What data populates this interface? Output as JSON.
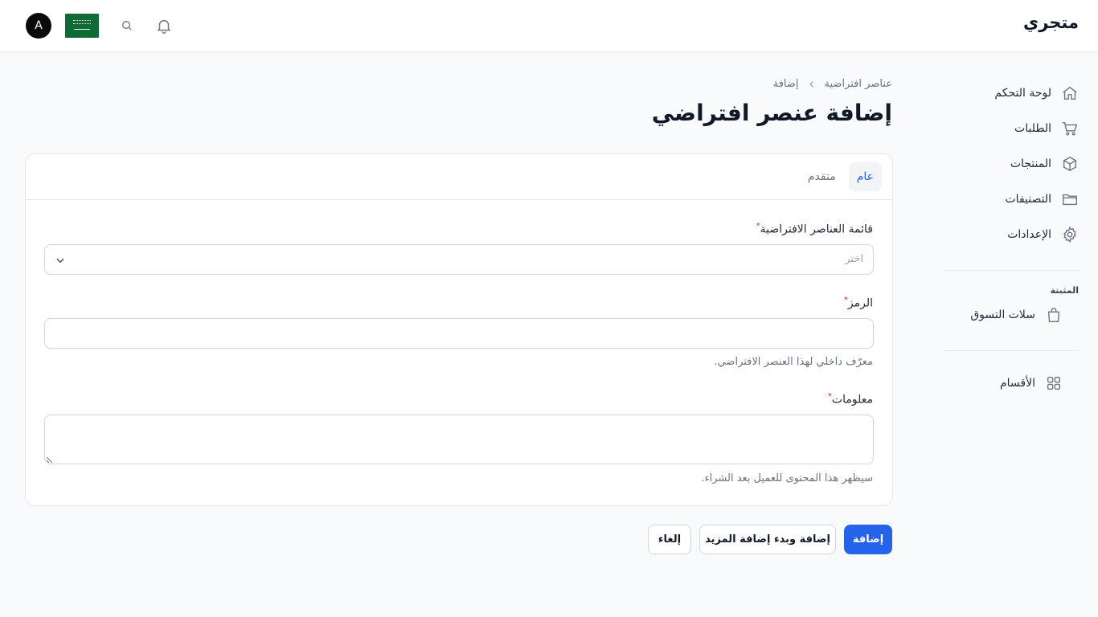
{
  "header": {
    "brand": "متجري",
    "avatar_initial": "A",
    "icons": [
      "bell-icon",
      "search-icon",
      "saudi-flag"
    ]
  },
  "sidebar": {
    "items": [
      {
        "label": "لوحة التحكم",
        "icon": "home-icon"
      },
      {
        "label": "الطلبات",
        "icon": "cart-icon"
      },
      {
        "label": "المنتجات",
        "icon": "box-icon"
      },
      {
        "label": "التصنيفات",
        "icon": "folder-icon"
      },
      {
        "label": "الإعدادات",
        "icon": "gear-icon"
      }
    ],
    "group_label": "المثبتة",
    "pinned": [
      {
        "label": "سلات التسوق",
        "icon": "shopping-bag-icon"
      }
    ],
    "extra": [
      {
        "label": "الأقسام",
        "icon": "grid-icon"
      }
    ]
  },
  "breadcrumb": {
    "parent": "عناصر افتراضية",
    "current": "إضافة"
  },
  "page_title": "إضافة عنصر افتراضي",
  "tabs": [
    {
      "label": "عام",
      "active": true
    },
    {
      "label": "متقدم",
      "active": false
    }
  ],
  "form": {
    "list_label": "قائمة العناصر الافتراضية",
    "list_placeholder": "اختر",
    "code_label": "الرمز",
    "code_value": "",
    "code_hint": "معرّف داخلي لهذا العنصر الافتراضي.",
    "info_label": "معلومات",
    "info_value": "",
    "info_hint": "سيظهر هذا المحتوى للعميل بعد الشراء.",
    "required_mark": "*"
  },
  "actions": {
    "add": "إضافة",
    "add_another": "إضافة وبدء إضافة المزيد",
    "cancel": "إلغاء"
  },
  "colors": {
    "accent": "#2563eb",
    "required": "#dc2626",
    "flag_green": "#0f6b34"
  }
}
